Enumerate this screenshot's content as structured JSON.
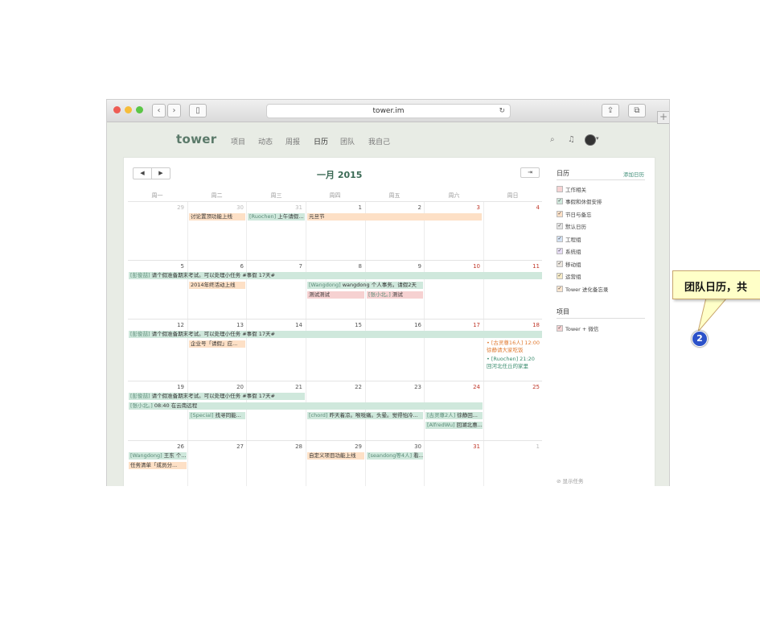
{
  "browser": {
    "url": "tower.im",
    "back": "‹",
    "forward": "›",
    "reload": "↻",
    "new_tab": "+"
  },
  "app": {
    "logo": "tower",
    "nav": [
      "项目",
      "动态",
      "周报",
      "日历",
      "团队",
      "我自己"
    ],
    "active_nav": "日历"
  },
  "calendar": {
    "month_title": "一月 2015",
    "prev": "◀",
    "next": "▶",
    "today_icon": "⇥",
    "weekdays": [
      "周一",
      "周二",
      "周三",
      "周四",
      "周五",
      "周六",
      "周日"
    ],
    "weeks": [
      [
        "29",
        "30",
        "31",
        "1",
        "2",
        "3",
        "4"
      ],
      [
        "5",
        "6",
        "7",
        "8",
        "9",
        "10",
        "11"
      ],
      [
        "12",
        "13",
        "14",
        "15",
        "16",
        "17",
        "18"
      ],
      [
        "19",
        "20",
        "21",
        "22",
        "23",
        "24",
        "25"
      ],
      [
        "26",
        "27",
        "28",
        "29",
        "30",
        "31",
        "1"
      ]
    ],
    "events": {
      "w1_a": {
        "text": "讨论置顶功能上线"
      },
      "w1_b": {
        "who": "[Ruochen]",
        "text": " 上午请假..."
      },
      "w1_c": {
        "text": "元旦节"
      },
      "w2_span": {
        "who": "[彭俊喆]",
        "text": " 请个假准备期末考试。可以处理小任务 #事假 17天#"
      },
      "w2_a": {
        "text": "2014年终活动上线"
      },
      "w2_b": {
        "who": "[Wangdong]",
        "text": " wangdong 个人事务。请假2天"
      },
      "w2_c": {
        "text": "测试测试"
      },
      "w2_d": {
        "who": "[张小北。]",
        "text": " 测试"
      },
      "w3_span": {
        "who": "[彭俊喆]",
        "text": " 请个假准备期末考试。可以处理小任务 #事假 17天#"
      },
      "w3_a": {
        "text": "企业号「请假」应..."
      },
      "w3_b1": {
        "text": "• [古灵尊16人] 12:00 徐静请大家吃饭"
      },
      "w3_b2": {
        "text": "• [Ruochen] 21:20 回河北任丘的家里"
      },
      "w4_span": {
        "who": "[彭俊喆]",
        "text": " 请个假准备期末考试。可以处理小任务 #事假 17天#"
      },
      "w4_span2": {
        "who": "[张小北。]",
        "text": " 08:40 在云南远程"
      },
      "w4_a": {
        "who": "[Special]",
        "text": " 找寻同能..."
      },
      "w4_b": {
        "who": "[chord]",
        "text": " 昨天着凉。喉咙痛。头晕。觉得怕冷..."
      },
      "w4_c": {
        "who": "[古灵尊2人]",
        "text": " 徐静回..."
      },
      "w4_d": {
        "who": "[AlfredWu]",
        "text": " 回湖北惠..."
      },
      "w5_a": {
        "who": "[Wangdong]",
        "text": " 王东 个..."
      },
      "w5_b": {
        "text": "任务清单「成员分..."
      },
      "w5_c": {
        "text": "自定义项目功能上线"
      },
      "w5_d": {
        "who": "[seandong等4人]",
        "text": " 看..."
      }
    }
  },
  "sidebar": {
    "calendar_title": "日历",
    "add_calendar": "添加日历",
    "calendars": [
      {
        "label": "工作相关",
        "color": "#f2b8b8",
        "checked": false
      },
      {
        "label": "事假和休假安排",
        "color": "#4aa37d",
        "checked": true
      },
      {
        "label": "节日与备忘",
        "color": "#f0a860",
        "checked": true
      },
      {
        "label": "默认日历",
        "color": "#999999",
        "checked": true
      },
      {
        "label": "工程组",
        "color": "#4f7fc0",
        "checked": true
      },
      {
        "label": "系统组",
        "color": "#9a76c8",
        "checked": true
      },
      {
        "label": "移动组",
        "color": "#b0a090",
        "checked": true
      },
      {
        "label": "运营组",
        "color": "#e0b040",
        "checked": true
      },
      {
        "label": "Tower 进化备忘录",
        "color": "#e8b070",
        "checked": true
      }
    ],
    "project_title": "项目",
    "projects": [
      {
        "label": "Tower + 微信",
        "color": "#d05050",
        "checked": true
      }
    ],
    "show_tasks": "显示任务"
  },
  "callout": {
    "text": "团队日历，共",
    "badge": "2"
  }
}
